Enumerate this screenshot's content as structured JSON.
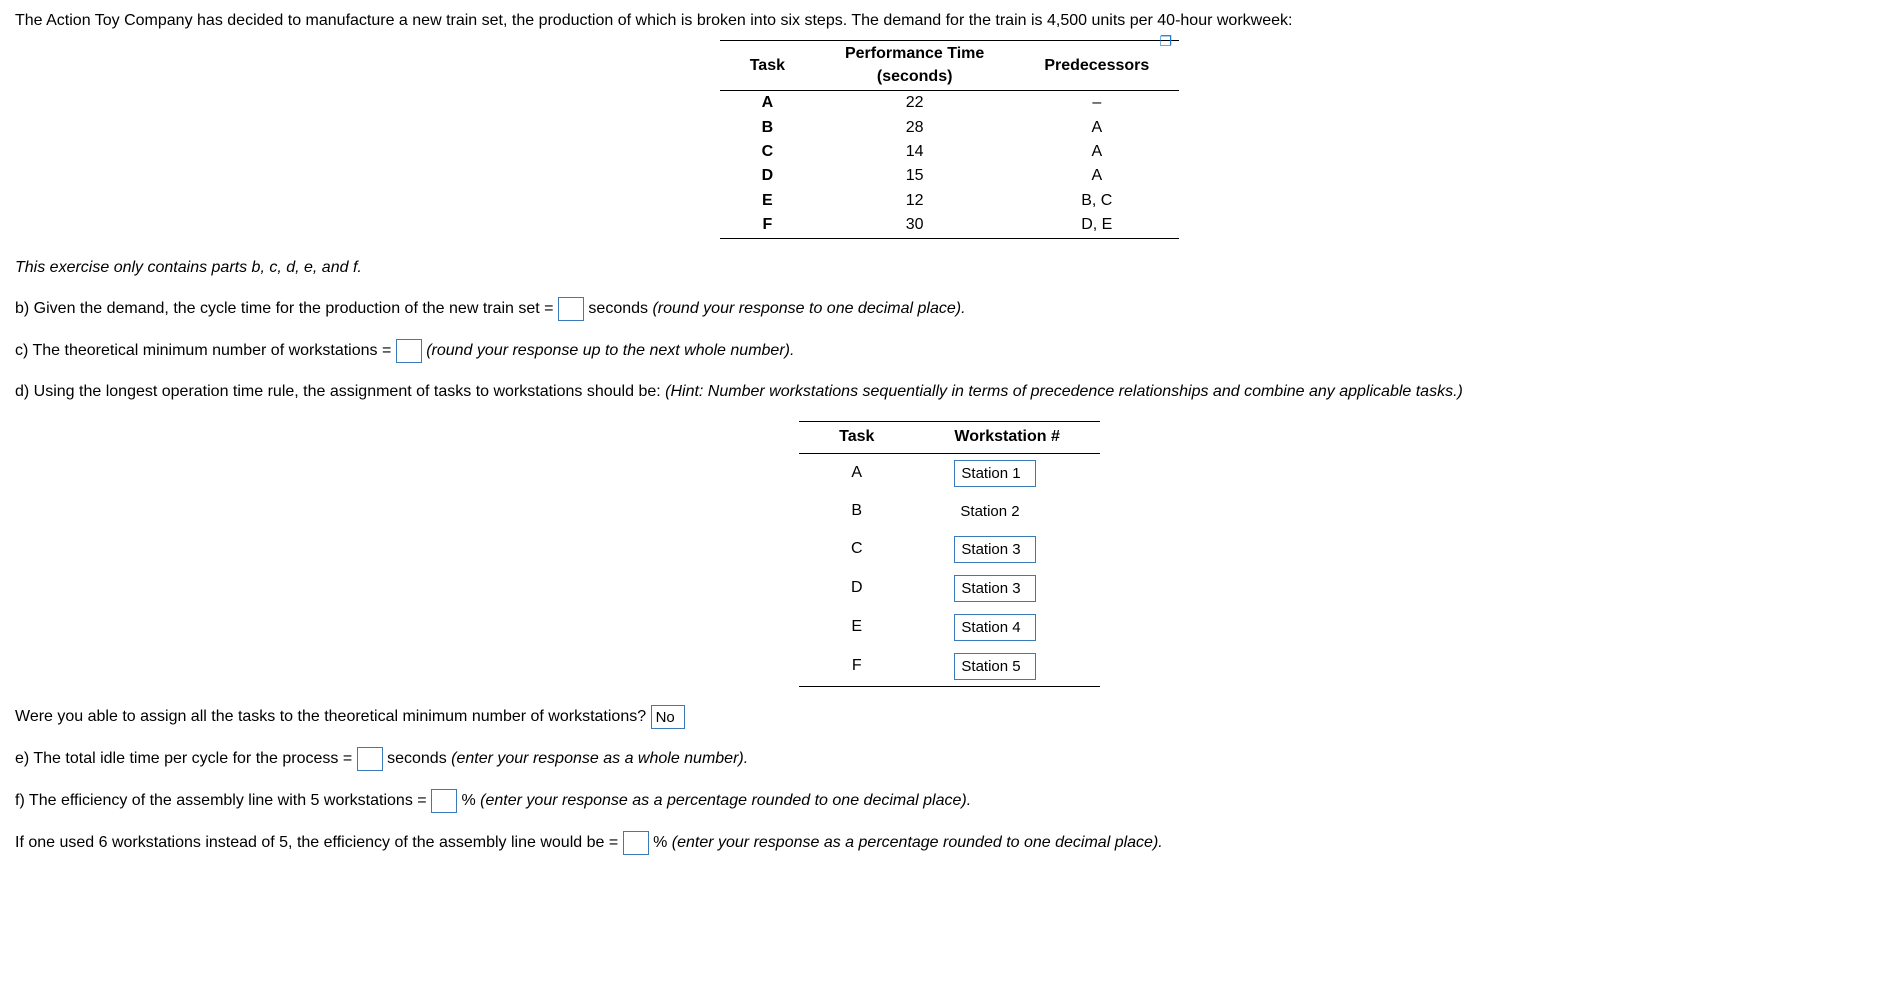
{
  "intro": "The Action Toy Company has decided to manufacture a new train set, the production of which is broken into six steps. The demand for the train is 4,500 units per 40-hour workweek:",
  "taskTable": {
    "headers": {
      "task": "Task",
      "time": "Performance Time (seconds)",
      "pred": "Predecessors"
    },
    "rows": [
      {
        "task": "A",
        "time": "22",
        "pred": "–"
      },
      {
        "task": "B",
        "time": "28",
        "pred": "A"
      },
      {
        "task": "C",
        "time": "14",
        "pred": "A"
      },
      {
        "task": "D",
        "time": "15",
        "pred": "A"
      },
      {
        "task": "E",
        "time": "12",
        "pred": "B, C"
      },
      {
        "task": "F",
        "time": "30",
        "pred": "D, E"
      }
    ]
  },
  "copyIcon": "❐",
  "partsNote": "This exercise only contains parts b, c, d, e, and f.",
  "partB": {
    "prefix": "b) Given the demand, the cycle time for the production of the new train set = ",
    "suffix": " seconds ",
    "hint": "(round your response to one decimal place)."
  },
  "partC": {
    "prefix": "c) The theoretical minimum number of workstations = ",
    "hint": " (round your response up to the next whole number)."
  },
  "partD": {
    "prefix": "d) Using the longest operation time rule, the assignment of tasks to workstations should be: ",
    "hint": "(Hint: Number workstations sequentially in terms of precedence relationships and combine any applicable tasks.)"
  },
  "assignTable": {
    "headers": {
      "task": "Task",
      "ws": "Workstation #"
    },
    "rows": [
      {
        "task": "A",
        "station": "Station 1",
        "boxed": true
      },
      {
        "task": "B",
        "station": "Station 2",
        "boxed": false
      },
      {
        "task": "C",
        "station": "Station 3",
        "boxed": true
      },
      {
        "task": "D",
        "station": "Station 3",
        "boxed": true
      },
      {
        "task": "E",
        "station": "Station 4",
        "boxed": true
      },
      {
        "task": "F",
        "station": "Station 5",
        "boxed": true
      }
    ]
  },
  "minQuestion": {
    "text": "Were you able to assign all the tasks to the theoretical minimum number of workstations? ",
    "answer": "No"
  },
  "partE": {
    "prefix": "e) The total idle time per cycle for the process = ",
    "suffix": " seconds ",
    "hint": "(enter your response as a whole number)."
  },
  "partF": {
    "prefix": "f) The efficiency of the assembly line with 5 workstations = ",
    "suffix": "% ",
    "hint": "(enter your response as a percentage rounded to one decimal place)."
  },
  "partF2": {
    "prefix": "If one used 6 workstations instead of 5, the efficiency of the assembly line would be = ",
    "suffix": "% ",
    "hint": "(enter your response as a percentage rounded to one decimal place)."
  }
}
